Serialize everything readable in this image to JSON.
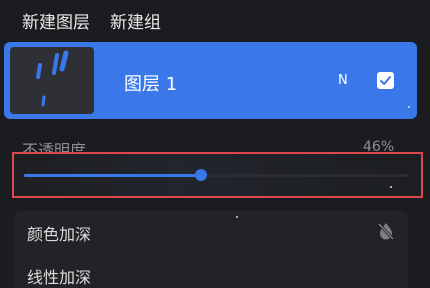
{
  "toolbar": {
    "new_layer": "新建图层",
    "new_group": "新建组"
  },
  "layer": {
    "name": "图层 1",
    "blend_mode_short": "N",
    "visible": true,
    "thumbnail_icon": "brush-strokes-thumbnail"
  },
  "opacity": {
    "label": "不透明度",
    "value_text": "46%",
    "value": 0.46
  },
  "blend_modes": {
    "items": [
      "颜色加深",
      "线性加深"
    ],
    "icon": "water-drop-off-icon"
  },
  "colors": {
    "accent": "#3a78ea",
    "background": "#1b1c1f",
    "highlight_border": "#e0474c"
  }
}
